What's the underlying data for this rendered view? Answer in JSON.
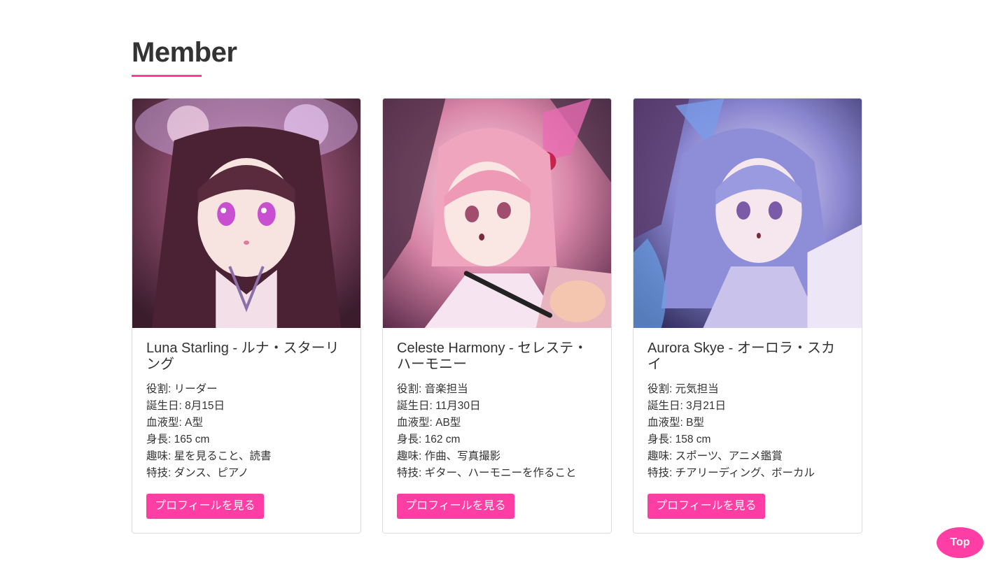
{
  "section": {
    "title": "Member"
  },
  "members": [
    {
      "name": "Luna Starling - ルナ・スターリング",
      "details": [
        "役割: リーダー",
        "誕生日: 8月15日",
        "血液型: A型",
        "身長: 165 cm",
        "趣味: 星を見ること、読書",
        "特技: ダンス、ピアノ"
      ],
      "button_label": "プロフィールを見る",
      "image_palette": "dark-brown-violet"
    },
    {
      "name": "Celeste Harmony - セレステ・ハーモニー",
      "details": [
        "役割: 音楽担当",
        "誕生日: 11月30日",
        "血液型: AB型",
        "身長: 162 cm",
        "趣味: 作曲、写真撮影",
        "特技: ギター、ハーモニーを作ること"
      ],
      "button_label": "プロフィールを見る",
      "image_palette": "pink-rose"
    },
    {
      "name": "Aurora Skye - オーロラ・スカイ",
      "details": [
        "役割: 元気担当",
        "誕生日: 3月21日",
        "血液型: B型",
        "身長: 158 cm",
        "趣味: スポーツ、アニメ鑑賞",
        "特技: チアリーディング、ボーカル"
      ],
      "button_label": "プロフィールを見る",
      "image_palette": "blue-lavender"
    }
  ],
  "top_button": {
    "label": "Top"
  },
  "colors": {
    "accent": "#ff3ea5",
    "text": "#333333",
    "card_border": "#dddddd"
  }
}
